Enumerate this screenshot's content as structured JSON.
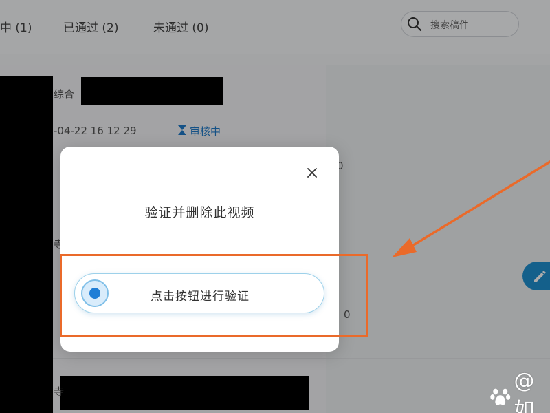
{
  "tabs": [
    {
      "label": "中 (1)"
    },
    {
      "label": "已通过 (2)"
    },
    {
      "label": "未通过 (0)"
    }
  ],
  "search": {
    "placeholder": "搜索稿件"
  },
  "list": {
    "item1": {
      "label_fragment": "综合",
      "datetime": "-04-22 16 12 29",
      "status": "审核中",
      "metric_fragment": "0"
    },
    "item2": {
      "label_fragment": "寺",
      "metric_fragment": "0"
    },
    "item3": {
      "label_fragment": "寺"
    }
  },
  "modal": {
    "title": "验证并删除此视频",
    "verify_button": "点击按钮进行验证"
  },
  "watermark": {
    "text": "@如"
  },
  "colors": {
    "accent": "#1f7ed6",
    "highlight": "#ea6a2a",
    "status": "#1e7ac8"
  }
}
